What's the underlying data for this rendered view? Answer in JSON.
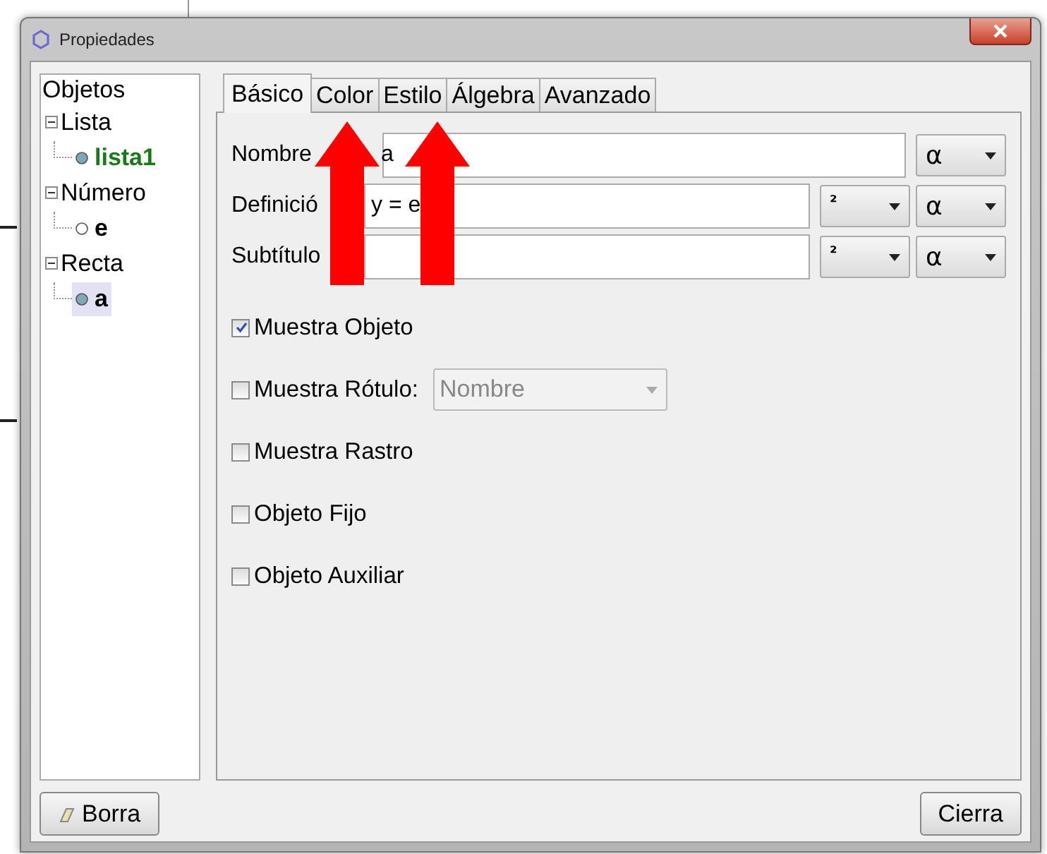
{
  "window": {
    "title": "Propiedades"
  },
  "tree": {
    "label": "Objetos",
    "children": [
      {
        "label": "Lista",
        "expanded": true,
        "children": [
          {
            "label": "lista1",
            "color": "#1a7a1a",
            "shown": true,
            "selected": false
          }
        ]
      },
      {
        "label": "Número",
        "expanded": true,
        "children": [
          {
            "label": "e",
            "color": "#000000",
            "shown": false,
            "selected": false
          }
        ]
      },
      {
        "label": "Recta",
        "expanded": true,
        "children": [
          {
            "label": "a",
            "color": "#000000",
            "shown": true,
            "selected": true
          }
        ]
      }
    ]
  },
  "tabs": [
    {
      "label": "Básico",
      "selected": true
    },
    {
      "label": "Color",
      "selected": false
    },
    {
      "label": "Estilo",
      "selected": false
    },
    {
      "label": "Álgebra",
      "selected": false
    },
    {
      "label": "Avanzado",
      "selected": false
    }
  ],
  "fields": [
    {
      "label": "Nombre",
      "value": "a",
      "menus": [
        "α"
      ]
    },
    {
      "label": "Definició",
      "value": "y = e",
      "menus": [
        "²",
        "α"
      ]
    },
    {
      "label": "Subtítulo",
      "menus": [
        "²",
        "α"
      ]
    }
  ],
  "checks": [
    {
      "label": "Muestra Objeto",
      "checked": true
    },
    {
      "label": "Muestra Rótulo:",
      "checked": false,
      "dropdown": {
        "value": "Nombre",
        "disabled": true
      }
    },
    {
      "label": "Muestra Rastro",
      "checked": false
    },
    {
      "label": "Objeto Fijo",
      "checked": false
    },
    {
      "label": "Objeto Auxiliar",
      "checked": false
    }
  ],
  "annotations": [
    {
      "kind": "arrow"
    },
    {
      "kind": "arrow"
    }
  ],
  "buttons": [
    {
      "label": "Borra",
      "kind": "delete"
    },
    {
      "label": "Cierra",
      "kind": "close"
    }
  ]
}
